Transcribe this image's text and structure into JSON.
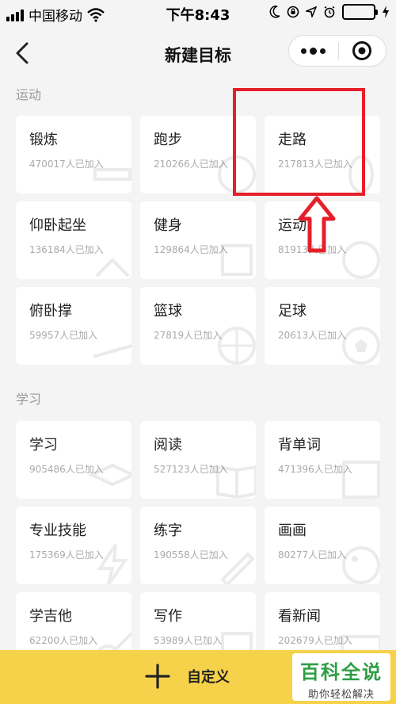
{
  "status_bar": {
    "carrier": "中国移动",
    "time": "下午8:43"
  },
  "nav": {
    "title": "新建目标"
  },
  "sections": [
    {
      "title": "运动",
      "items": [
        {
          "name": "锻炼",
          "count": "470017人已加入"
        },
        {
          "name": "跑步",
          "count": "210266人已加入"
        },
        {
          "name": "走路",
          "count": "217813人已加入"
        },
        {
          "name": "仰卧起坐",
          "count": "136184人已加入"
        },
        {
          "name": "健身",
          "count": "129864人已加入"
        },
        {
          "name": "运动",
          "count": "81913人已加入"
        },
        {
          "name": "俯卧撑",
          "count": "59957人已加入"
        },
        {
          "name": "篮球",
          "count": "27819人已加入"
        },
        {
          "name": "足球",
          "count": "20613人已加入"
        }
      ]
    },
    {
      "title": "学习",
      "items": [
        {
          "name": "学习",
          "count": "905486人已加入"
        },
        {
          "name": "阅读",
          "count": "527123人已加入"
        },
        {
          "name": "背单词",
          "count": "471396人已加入"
        },
        {
          "name": "专业技能",
          "count": "175369人已加入"
        },
        {
          "name": "练字",
          "count": "190558人已加入"
        },
        {
          "name": "画画",
          "count": "80277人已加入"
        },
        {
          "name": "学吉他",
          "count": "62200人已加入"
        },
        {
          "name": "写作",
          "count": "53989人已加入"
        },
        {
          "name": "看新闻",
          "count": "202679人已加入"
        }
      ]
    }
  ],
  "bottom": {
    "custom_label": "自定义"
  },
  "watermark": {
    "title": "百科全说",
    "subtitle": "助你轻松解决"
  },
  "colors": {
    "accent_yellow": "#f6d24a",
    "highlight_red": "#e5202a",
    "battery_green": "#4cd964"
  }
}
